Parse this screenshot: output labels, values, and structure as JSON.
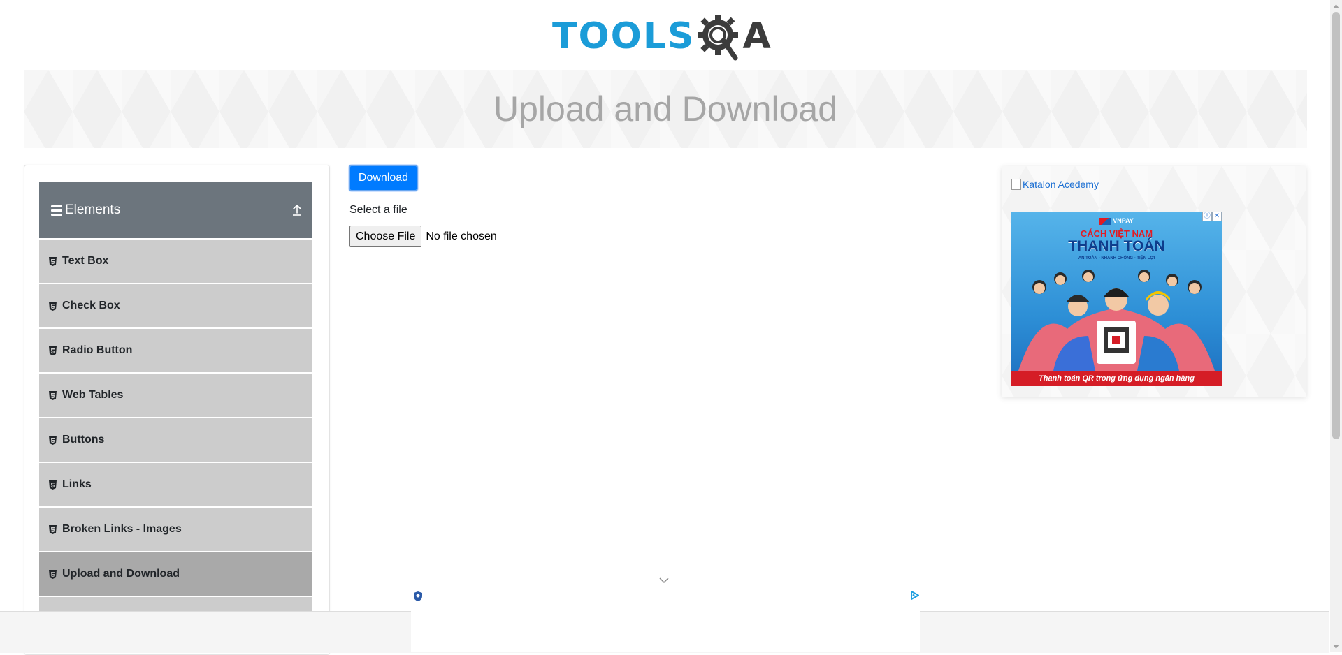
{
  "logo": {
    "text_tools": "TOOLS",
    "text_a": "A"
  },
  "banner": {
    "title": "Upload and Download"
  },
  "sidebar": {
    "group_title": "Elements",
    "items": [
      {
        "label": "Text Box"
      },
      {
        "label": "Check Box"
      },
      {
        "label": "Radio Button"
      },
      {
        "label": "Web Tables"
      },
      {
        "label": "Buttons"
      },
      {
        "label": "Links"
      },
      {
        "label": "Broken Links - Images"
      },
      {
        "label": "Upload and Download"
      }
    ],
    "active_item": "Upload and Download"
  },
  "main": {
    "download_label": "Download",
    "select_label": "Select a file",
    "choose_file_label": "Choose File",
    "file_status": "No file chosen"
  },
  "ad": {
    "katalon_alt": "Katalon Acedemy",
    "brand": "VNPAY",
    "headline1": "CÁCH VIỆT NAM",
    "headline2": "THANH TOÁN",
    "tagline": "AN TOÀN - NHANH CHÓNG - TIỆN LỢI",
    "footer": "Thanh toán QR trong ứng dụng ngân hàng"
  },
  "colors": {
    "primary": "#007bff",
    "sidebar_header": "#6c757d",
    "menu_item": "#cccccc",
    "menu_item_active": "#a9a9a9",
    "logo_blue": "#1b9cd8"
  }
}
